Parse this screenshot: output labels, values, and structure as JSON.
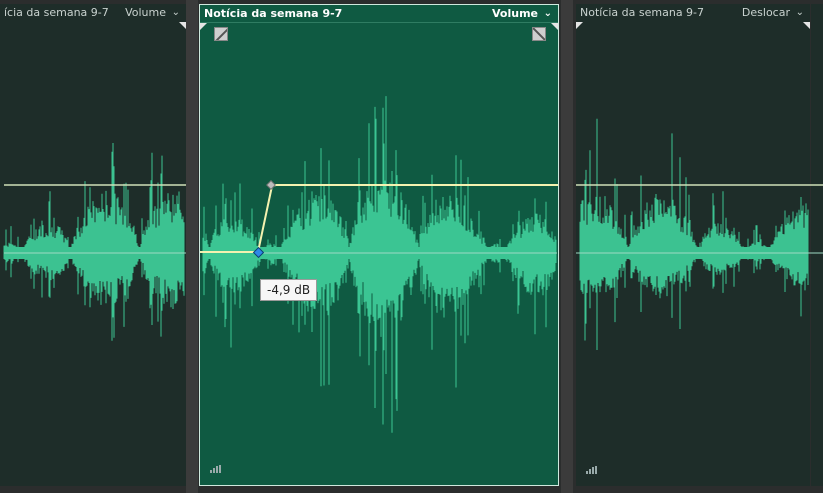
{
  "clips": [
    {
      "title": "ícia da semana 9-7",
      "mode": "Volume"
    },
    {
      "title": "Notícia da semana 9-7",
      "mode": "Volume"
    },
    {
      "title": "Notícia da semana 9-7",
      "mode": "Deslocar"
    }
  ],
  "envelope": {
    "tooltip": "-4,9 dB"
  },
  "colors": {
    "waveform": "#3fcf9a",
    "selected_clip": "#0f5a42",
    "envelope_active": "#f4f2b0",
    "envelope_inactive": "#cfe0b8",
    "keyframe": "#2e8ae6"
  },
  "icons": [
    "caret-down-icon",
    "fade-in-icon",
    "fade-out-icon",
    "level-meter-icon"
  ]
}
